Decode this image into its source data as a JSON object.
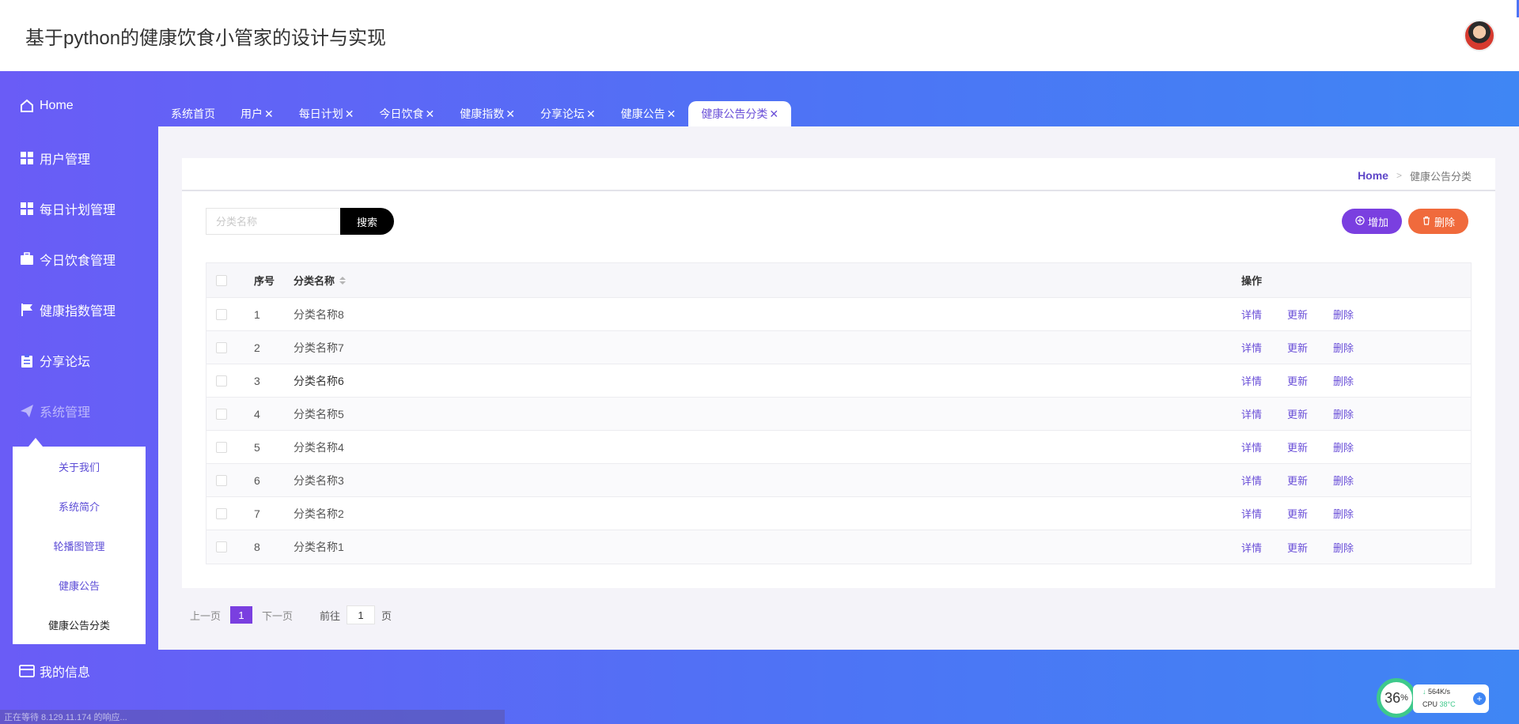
{
  "header": {
    "title": "基于python的健康饮食小管家的设计与实现"
  },
  "sidebar": {
    "items": [
      {
        "label": "Home",
        "icon": "home-icon"
      },
      {
        "label": "用户管理",
        "icon": "grid-icon"
      },
      {
        "label": "每日计划管理",
        "icon": "grid-icon"
      },
      {
        "label": "今日饮食管理",
        "icon": "briefcase-icon"
      },
      {
        "label": "健康指数管理",
        "icon": "flag-icon"
      },
      {
        "label": "分享论坛",
        "icon": "clipboard-icon"
      },
      {
        "label": "系统管理",
        "icon": "paper-plane-icon"
      },
      {
        "label": "我的信息",
        "icon": "card-icon"
      }
    ],
    "submenu": [
      "关于我们",
      "系统简介",
      "轮播图管理",
      "健康公告",
      "健康公告分类"
    ]
  },
  "tabs": [
    {
      "label": "系统首页",
      "closable": false
    },
    {
      "label": "用户",
      "closable": true
    },
    {
      "label": "每日计划",
      "closable": true
    },
    {
      "label": "今日饮食",
      "closable": true
    },
    {
      "label": "健康指数",
      "closable": true
    },
    {
      "label": "分享论坛",
      "closable": true
    },
    {
      "label": "健康公告",
      "closable": true
    },
    {
      "label": "健康公告分类",
      "closable": true
    }
  ],
  "tab_close_glyph": "✕",
  "breadcrumb": {
    "home": "Home",
    "sep": ">",
    "current": "健康公告分类"
  },
  "search": {
    "placeholder": "分类名称",
    "button": "搜索"
  },
  "actions": {
    "add": "增加",
    "delete": "删除"
  },
  "table": {
    "headers": {
      "index": "序号",
      "name": "分类名称",
      "ops": "操作"
    },
    "ops": [
      "详情",
      "更新",
      "删除"
    ],
    "rows": [
      {
        "index": "1",
        "name": "分类名称8"
      },
      {
        "index": "2",
        "name": "分类名称7"
      },
      {
        "index": "3",
        "name": "分类名称6"
      },
      {
        "index": "4",
        "name": "分类名称5"
      },
      {
        "index": "5",
        "name": "分类名称4"
      },
      {
        "index": "6",
        "name": "分类名称3"
      },
      {
        "index": "7",
        "name": "分类名称2"
      },
      {
        "index": "8",
        "name": "分类名称1"
      }
    ]
  },
  "pager": {
    "prev": "上一页",
    "page": "1",
    "next": "下一页",
    "goto": "前往",
    "input": "1",
    "unit": "页"
  },
  "status_bar": "正在等待 8.129.11.174 的响应...",
  "widget": {
    "percent": "36",
    "percent_sign": "%",
    "net_speed": "564K/s",
    "cpu_label": "CPU",
    "cpu_temp": "38°C"
  },
  "colors": {
    "accent": "#7a3fe0",
    "danger": "#f06a3c",
    "sidebar_start": "#6a5cf6",
    "sidebar_end": "#3f86f4"
  }
}
